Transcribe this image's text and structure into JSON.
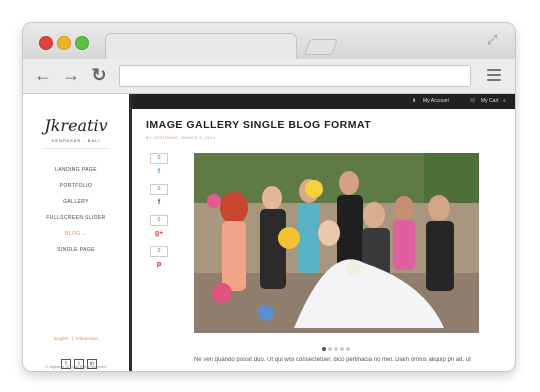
{
  "site": {
    "brand": "Jkreativ",
    "tagline": "DENPASAR - BALI",
    "nav": [
      "LANDING PAGE",
      "PORTFOLIO",
      "GALLERY",
      "FULLSCREEN SLIDER",
      "BLOG",
      "SINGLE PAGE"
    ],
    "active_nav": "BLOG",
    "languages": [
      "English",
      "Indonesian"
    ],
    "social": [
      "f",
      "t",
      "in"
    ],
    "copyright": "© Jegtheme 2013. All Rights Reserved."
  },
  "topbar": {
    "account": "My Account",
    "cart": "My Cart"
  },
  "post": {
    "title": "IMAGE GALLERY SINGLE BLOG FORMAT",
    "meta_prefix": "BY",
    "author": "JEGTHEME",
    "date": "MARCH 6, 2014",
    "share_counts": [
      "0",
      "0",
      "0",
      "0"
    ],
    "excerpt": "Ne veri quando possit duo. Ut qui wisi consectetuer, dico pertinacia no mel. Diam omnis aliquip pri ad, ut"
  },
  "colors": {
    "accent": "#e38e5a",
    "topbar": "#222222"
  }
}
